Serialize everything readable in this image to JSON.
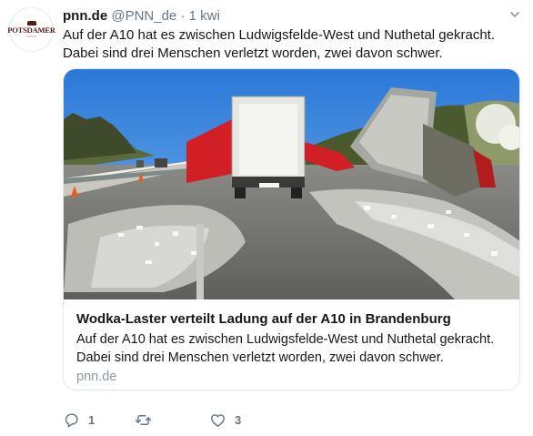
{
  "tweet": {
    "display_name": "pnn.de",
    "handle": "@PNN_de",
    "separator": "·",
    "time": "1 kwi",
    "text": "Auf der A10 hat es zwischen Ludwigsfelde-West und Nuthetal gekracht. Dabei sind drei Menschen verletzt worden, zwei davon schwer."
  },
  "avatar": {
    "logo_text": "POTSDAMER",
    "colors": {
      "brand": "#5a1a18"
    }
  },
  "card": {
    "title": "Wodka-Laster verteilt Ladung auf der A10 in Brandenburg",
    "description": "Auf der A10 hat es zwischen Ludwigsfelde-West und Nuthetal gekracht. Dabei sind drei Menschen verletzt worden, zwei davon schwer.",
    "domain": "pnn.de"
  },
  "actions": {
    "reply": {
      "icon": "reply-icon",
      "count": "1"
    },
    "retweet": {
      "icon": "retweet-icon",
      "count": ""
    },
    "like": {
      "icon": "heart-icon",
      "count": "3"
    }
  },
  "colors": {
    "text": "#14171a",
    "secondary": "#657786",
    "border": "#e1e8ed",
    "domain": "#8899a6"
  }
}
